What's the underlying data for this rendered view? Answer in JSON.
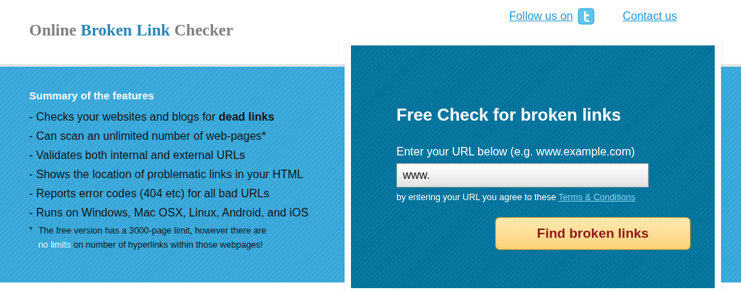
{
  "logo": [
    {
      "text": "Online",
      "highlight": false
    },
    {
      "text": "Broken",
      "highlight": true
    },
    {
      "text": "Link",
      "highlight": true
    },
    {
      "text": "Checker",
      "highlight": false
    }
  ],
  "header_links": [
    {
      "label": "Follow us on",
      "kind": "twitter"
    },
    {
      "label": "Contact us",
      "kind": "plain"
    }
  ],
  "features": {
    "title": "Summary of the features",
    "items": [
      "- Checks your websites and blogs for **dead links**",
      "- Can scan an unlimited number of web-pages*",
      "- Validates both internal and external URLs",
      "- Shows the location of problematic links in your HTML",
      "- Reports error codes (404 etc) for all bad URLs",
      "- Runs on Windows, Mac OSX, Linux, Android, and iOS"
    ],
    "footnote_mark": "*",
    "footnote_before": "The free version has a 3000-page limit, however there are",
    "footnote_link": "no limits",
    "footnote_after": "on number of hyperlinks within those webpages!"
  },
  "check_form": {
    "title": "Free Check for broken links",
    "label": "Enter your URL below (e.g. www.example.com)",
    "url_value": "www.",
    "agreement": "by entering your URL you agree to these",
    "terms_link": "Terms & Conditions",
    "submit": "Find broken links"
  }
}
